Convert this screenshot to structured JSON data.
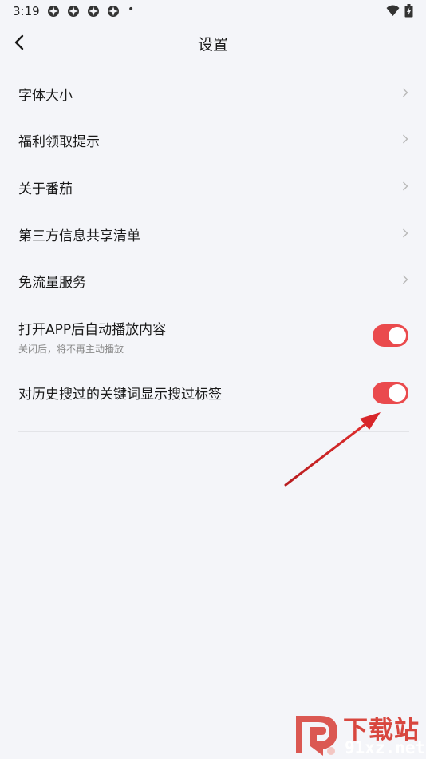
{
  "status_bar": {
    "time": "3:19"
  },
  "header": {
    "title": "设置"
  },
  "nav_rows": [
    {
      "label": "字体大小"
    },
    {
      "label": "福利领取提示"
    },
    {
      "label": "关于番茄"
    },
    {
      "label": "第三方信息共享清单"
    },
    {
      "label": "免流量服务"
    }
  ],
  "toggle_rows": [
    {
      "label": "打开APP后自动播放内容",
      "sublabel": "关闭后，将不再主动播放",
      "enabled": true
    },
    {
      "label": "对历史搜过的关键词显示搜过标签",
      "enabled": true
    }
  ],
  "watermark": {
    "title": "下载站",
    "url": "91xz.net"
  },
  "colors": {
    "accent": "#ea4a4d",
    "background": "#f4f5f9",
    "arrow": "#d8262a"
  }
}
